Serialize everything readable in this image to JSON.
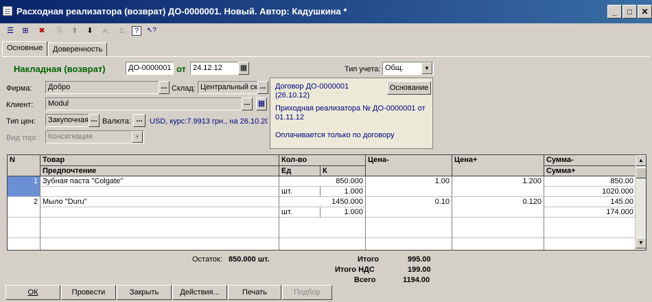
{
  "window": {
    "title": "Расходная реализатора  (возврат) ДО-0000001. Новый. Автор: Кадушкина *",
    "minimize": "_",
    "maximize": "□",
    "close": "✕"
  },
  "toolbar": {
    "items": [
      "new-icon",
      "copy-icon",
      "delete-icon",
      "print-icon",
      "up-arrow-icon",
      "down-arrow-icon",
      "sort-asc-icon",
      "sort-desc-icon",
      "help-icon",
      "pointer-help-icon"
    ],
    "glyphs": [
      "☰",
      "⊞",
      "✖",
      "⎘",
      "⬆",
      "⬇",
      "A↓",
      "Z↓",
      "?",
      "↖?"
    ]
  },
  "tabs": [
    {
      "label": "Основные"
    },
    {
      "label": "Доверенность"
    }
  ],
  "header": {
    "doc_label": "Накладная (возврат)",
    "doc_number": "ДО-0000001",
    "from_label": "от",
    "date": "24.12.12",
    "calendar_glyph": "▦",
    "accounting_type_label": "Тип учета:",
    "accounting_type_value": "Общ.",
    "combo_arrow": "▼"
  },
  "form": {
    "firm_label": "Фирма:",
    "firm_value": "Добро",
    "warehouse_label": "Склад:",
    "warehouse_value": "Центральный ск",
    "client_label": "Клиент:",
    "client_value": "Modul",
    "price_type_label": "Тип цен:",
    "price_type_value": "Закупочная",
    "currency_label": "Валюта:",
    "currency_value": "USD, курс:7.9913 грн., на 26.10.20",
    "trade_type_label": "Вид торг.:",
    "trade_type_value": "Консигнация",
    "dots": "...",
    "table_glyph": "▦"
  },
  "info": {
    "contract": "Договор ДО-0000001 (26.10.12)",
    "basis_button": "Основание",
    "incoming": "Приходная реализатора № ДО-0000001 от 01.11.12",
    "payment_note": "Оплачивается только по договору"
  },
  "grid": {
    "headers": {
      "n": "N",
      "product": "Товар",
      "preference": "Предпочтение",
      "qty": "Кол-во",
      "unit": "Ед",
      "k": "К",
      "price_minus": "Цена-",
      "price_plus": "Цена+",
      "sum_minus": "Сумма-",
      "sum_plus": "Сумма+"
    },
    "rows": [
      {
        "n": "1",
        "product": "Зубная паста \"Colgate\"",
        "qty": "850.000",
        "unit": "шт.",
        "k": "1.000",
        "price_minus": "1.00",
        "price_plus": "1.200",
        "sum_minus": "850.00",
        "sum_plus": "1020.000"
      },
      {
        "n": "2",
        "product": "Мыло \"Duru\"",
        "qty": "1450.000",
        "unit": "шт.",
        "k": "1.000",
        "price_minus": "0.10",
        "price_plus": "0.120",
        "sum_minus": "145.00",
        "sum_plus": "174.000"
      }
    ]
  },
  "totals": {
    "balance_label": "Остаток:",
    "balance_value": "850.000 шт.",
    "total_label": "Итого",
    "total_value": "995.00",
    "vat_label": "Итого НДС",
    "vat_value": "199.00",
    "grand_label": "Всего",
    "grand_value": "1194.00"
  },
  "buttons": {
    "ok": "ОК",
    "post": "Провести",
    "close": "Закрыть",
    "actions": "Действия...",
    "print": "Печать",
    "pick": "Подбор"
  }
}
